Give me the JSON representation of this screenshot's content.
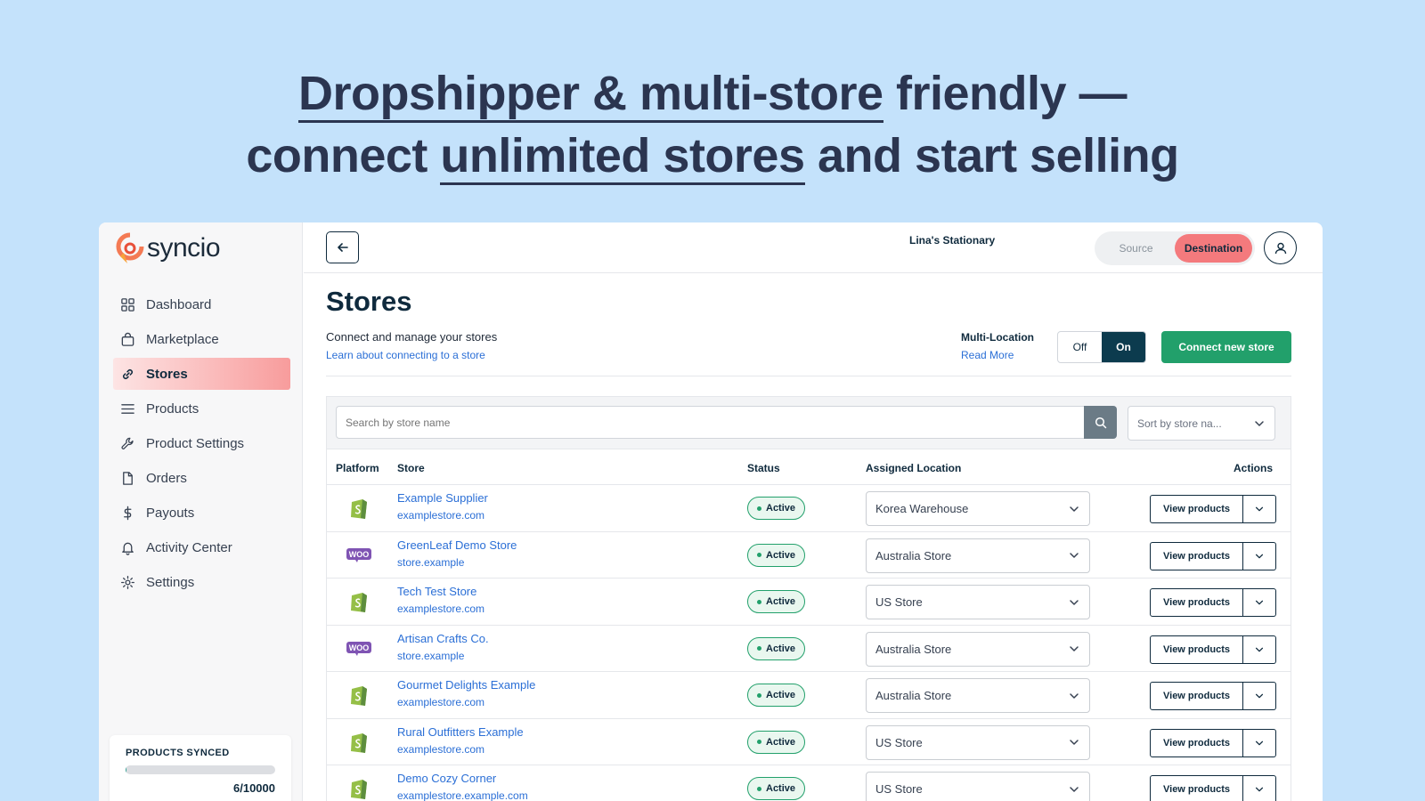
{
  "headline": {
    "line1_a": "Dropshipper & multi-store",
    "line1_b": " friendly —",
    "line2_a": "connect ",
    "line2_b": "unlimited stores",
    "line2_c": " and start selling"
  },
  "brand": {
    "name": "syncio"
  },
  "sidebar": {
    "items": [
      {
        "label": "Dashboard",
        "icon": "grid-icon"
      },
      {
        "label": "Marketplace",
        "icon": "bag-icon"
      },
      {
        "label": "Stores",
        "icon": "link-icon",
        "active": true
      },
      {
        "label": "Products",
        "icon": "list-icon"
      },
      {
        "label": "Product Settings",
        "icon": "wrench-icon"
      },
      {
        "label": "Orders",
        "icon": "file-icon"
      },
      {
        "label": "Payouts",
        "icon": "dollar-icon"
      },
      {
        "label": "Activity Center",
        "icon": "bell-icon"
      },
      {
        "label": "Settings",
        "icon": "gear-icon"
      }
    ],
    "sync": {
      "title": "PRODUCTS SYNCED",
      "count": "6/10000",
      "fraction": 0.0006
    }
  },
  "topbar": {
    "store_name": "Lina's Stationary",
    "mode_source": "Source",
    "mode_destination": "Destination"
  },
  "page": {
    "title": "Stores",
    "subtitle": "Connect and manage your stores",
    "learn_link": "Learn about connecting to a store",
    "multi_location_label": "Multi-Location",
    "read_more": "Read More",
    "toggle_off": "Off",
    "toggle_on": "On",
    "connect_button": "Connect new store"
  },
  "search": {
    "placeholder": "Search by store name",
    "sort_label": "Sort by store na..."
  },
  "table": {
    "headers": {
      "platform": "Platform",
      "store": "Store",
      "status": "Status",
      "location": "Assigned Location",
      "actions": "Actions"
    },
    "action_label": "View products",
    "rows": [
      {
        "platform": "shopify",
        "name": "Example Supplier",
        "url": "examplestore.com",
        "status": "Active",
        "location": "Korea Warehouse"
      },
      {
        "platform": "woo",
        "name": "GreenLeaf Demo Store",
        "url": "store.example",
        "status": "Active",
        "location": "Australia Store"
      },
      {
        "platform": "shopify",
        "name": "Tech Test Store",
        "url": "examplestore.com",
        "status": "Active",
        "location": "US Store"
      },
      {
        "platform": "woo",
        "name": "Artisan Crafts Co.",
        "url": "store.example",
        "status": "Active",
        "location": "Australia Store"
      },
      {
        "platform": "shopify",
        "name": "Gourmet Delights Example",
        "url": "examplestore.com",
        "status": "Active",
        "location": "Australia Store"
      },
      {
        "platform": "shopify",
        "name": "Rural Outfitters Example",
        "url": "examplestore.com",
        "status": "Active",
        "location": "US Store"
      },
      {
        "platform": "shopify",
        "name": "Demo Cozy Corner",
        "url": "examplestore.example.com",
        "status": "Active",
        "location": "US Store"
      }
    ]
  },
  "colors": {
    "accent": "#f47a7d",
    "primary_dark": "#0c3b4e",
    "success": "#22a06b",
    "link": "#2b6fd6"
  }
}
